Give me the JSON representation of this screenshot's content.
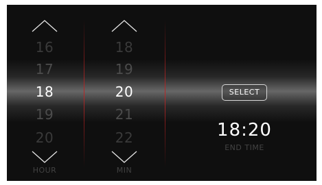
{
  "hour_picker": {
    "values": [
      "16",
      "17",
      "18",
      "19",
      "20"
    ],
    "selected": "18",
    "label": "HOUR",
    "up_icon": "chevron-up-icon",
    "down_icon": "chevron-down-icon"
  },
  "minute_picker": {
    "values": [
      "18",
      "19",
      "20",
      "21",
      "22"
    ],
    "selected": "20",
    "label": "MIN",
    "up_icon": "chevron-up-icon",
    "down_icon": "chevron-down-icon"
  },
  "select_button": {
    "label": "SELECT"
  },
  "result": {
    "time": "18:20",
    "label": "END TIME"
  },
  "colors": {
    "background": "#0f0f0f",
    "highlight_band": "#d8d8d8",
    "divider": "#b92828",
    "selected_text": "#ffffff",
    "dim_text": "#3a3a3a"
  }
}
